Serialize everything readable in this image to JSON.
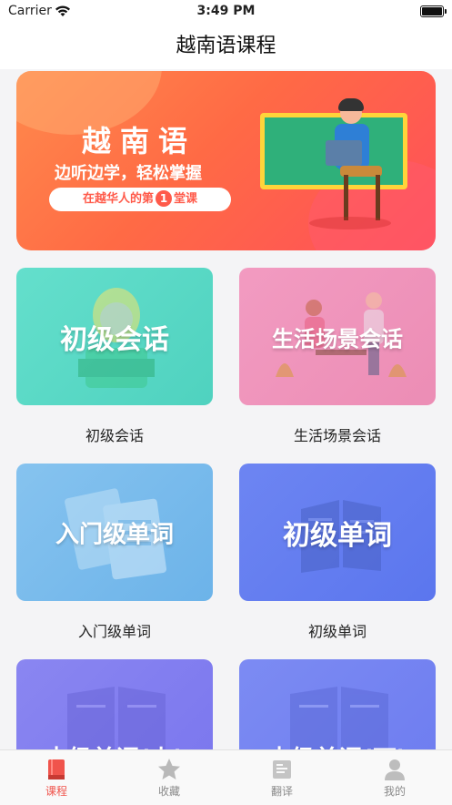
{
  "status_bar": {
    "carrier": "Carrier",
    "time": "3:49 PM",
    "icons": [
      "wifi-icon",
      "battery-icon"
    ]
  },
  "nav": {
    "title": "越南语课程"
  },
  "banner": {
    "title": "越南语",
    "subtitle": "边听边学，轻松掌握",
    "pill_prefix": "在越华人的第",
    "pill_number": "1",
    "pill_suffix": "堂课"
  },
  "courses": [
    {
      "card_text": "初级会话",
      "label": "初级会话",
      "color": "#5dd9c7"
    },
    {
      "card_text": "生活场景会话",
      "label": "生活场景会话",
      "color": "#ef94bb"
    },
    {
      "card_text": "入门级单词",
      "label": "入门级单词",
      "color": "#7abbeb"
    },
    {
      "card_text": "初级单词",
      "label": "初级单词",
      "color": "#637df0"
    },
    {
      "card_text": "中级单词(上)",
      "label": "",
      "color": "#8480f0"
    },
    {
      "card_text": "中级单词(下)",
      "label": "",
      "color": "#7584f1"
    }
  ],
  "tabs": [
    {
      "label": "课程",
      "icon": "book-icon",
      "active": true
    },
    {
      "label": "收藏",
      "icon": "star-icon",
      "active": false
    },
    {
      "label": "翻译",
      "icon": "translate-icon",
      "active": false
    },
    {
      "label": "我的",
      "icon": "person-icon",
      "active": false
    }
  ],
  "colors": {
    "accent": "#f0544c",
    "inactive_tab": "#8a8a8a",
    "banner_start": "#ff8a4c",
    "banner_end": "#ff4f5a"
  }
}
